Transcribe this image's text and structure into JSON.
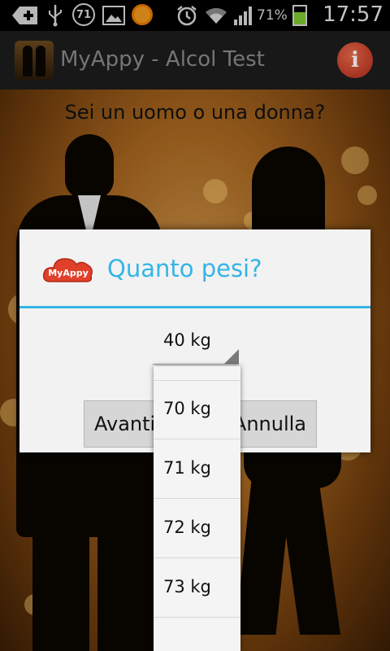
{
  "status_bar": {
    "notification_count": "71",
    "battery_percent": "71%",
    "time": "17:57",
    "icons": [
      "add-icon",
      "usb-icon",
      "image-icon",
      "orange-app-icon",
      "alarm-icon",
      "wifi-icon",
      "signal-icon",
      "battery-charging-icon"
    ]
  },
  "action_bar": {
    "title": "MyAppy - Alcol Test",
    "info_button_label": "i"
  },
  "screen": {
    "question": "Sei un uomo o una donna?"
  },
  "dialog": {
    "logo_text": "MyAppy",
    "title": "Quanto pesi?",
    "spinner_value": "40 kg",
    "ok_label": "Avanti",
    "cancel_label": "Annulla"
  },
  "dropdown": {
    "options": [
      "70 kg",
      "71 kg",
      "72 kg",
      "73 kg"
    ]
  },
  "colors": {
    "accent": "#33b5e5",
    "info_red": "#c0392b",
    "logo_red": "#e0402a"
  }
}
